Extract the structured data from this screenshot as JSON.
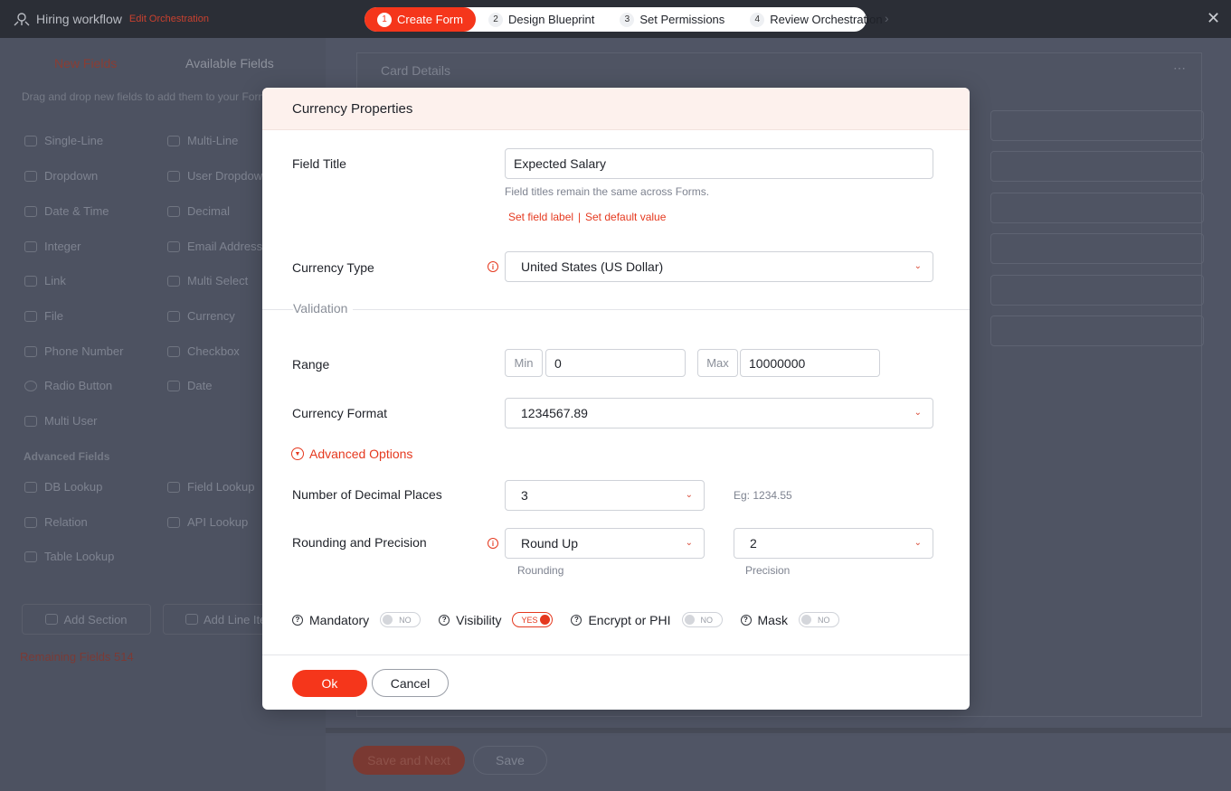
{
  "app": {
    "title": "Hiring workflow",
    "subtitle": "Edit Orchestration"
  },
  "steps": [
    {
      "num": "1",
      "label": "Create Form",
      "active": true
    },
    {
      "num": "2",
      "label": "Design Blueprint"
    },
    {
      "num": "3",
      "label": "Set Permissions"
    },
    {
      "num": "4",
      "label": "Review Orchestration"
    }
  ],
  "left": {
    "tab_new": "New Fields",
    "tab_available": "Available Fields",
    "hint": "Drag and drop new fields to add them to your Form",
    "fields": [
      {
        "label": "Single-Line",
        "icon": "single-line-icon"
      },
      {
        "label": "Multi-Line",
        "icon": "multi-line-icon"
      },
      {
        "label": "Dropdown",
        "icon": "dropdown-icon"
      },
      {
        "label": "User Dropdown",
        "icon": "user-dropdown-icon"
      },
      {
        "label": "Date & Time",
        "icon": "date-time-icon"
      },
      {
        "label": "Decimal",
        "icon": "decimal-icon"
      },
      {
        "label": "Integer",
        "icon": "integer-icon"
      },
      {
        "label": "Email Address",
        "icon": "email-icon"
      },
      {
        "label": "Link",
        "icon": "link-icon"
      },
      {
        "label": "Multi Select",
        "icon": "multi-select-icon"
      },
      {
        "label": "File",
        "icon": "file-icon"
      },
      {
        "label": "Currency",
        "icon": "currency-icon"
      },
      {
        "label": "Phone Number",
        "icon": "phone-icon"
      },
      {
        "label": "Checkbox",
        "icon": "checkbox-icon"
      },
      {
        "label": "Radio Button",
        "icon": "radio-icon"
      },
      {
        "label": "Date",
        "icon": "date-icon"
      },
      {
        "label": "Multi User",
        "icon": "multi-user-icon"
      }
    ],
    "advanced_heading": "Advanced Fields",
    "advanced_fields": [
      {
        "label": "DB Lookup",
        "icon": "db-lookup-icon"
      },
      {
        "label": "Field Lookup",
        "icon": "field-lookup-icon"
      },
      {
        "label": "Relation",
        "icon": "relation-icon"
      },
      {
        "label": "API Lookup",
        "icon": "api-lookup-icon"
      },
      {
        "label": "Table Lookup",
        "icon": "table-lookup-icon"
      }
    ],
    "add_section": "Add Section",
    "add_line_item": "Add Line Item",
    "remaining": "Remaining Fields 514"
  },
  "canvas": {
    "card_title": "Card Details",
    "save_next": "Save and Next",
    "save": "Save"
  },
  "modal": {
    "title": "Currency Properties",
    "field_title_label": "Field Title",
    "field_title_value": "Expected Salary",
    "field_title_hint": "Field titles remain the same across Forms.",
    "set_field_label": "Set field label",
    "link_sep": "|",
    "set_default_value": "Set default value",
    "currency_type_label": "Currency Type",
    "currency_type_value": "United States (US Dollar)",
    "validation_label": "Validation",
    "range_label": "Range",
    "min_label": "Min",
    "min_value": "0",
    "max_label": "Max",
    "max_value": "10000000",
    "currency_format_label": "Currency Format",
    "currency_format_value": "1234567.89",
    "advanced_options": "Advanced Options",
    "decimal_places_label": "Number of Decimal Places",
    "decimal_places_value": "3",
    "decimal_example": "Eg: 1234.55",
    "rounding_label": "Rounding and Precision",
    "rounding_value": "Round Up",
    "rounding_caption": "Rounding",
    "precision_value": "2",
    "precision_caption": "Precision",
    "toggles": [
      {
        "label": "Mandatory",
        "state": "NO",
        "on": false
      },
      {
        "label": "Visibility",
        "state": "YES",
        "on": true
      },
      {
        "label": "Encrypt or PHI",
        "state": "NO",
        "on": false
      },
      {
        "label": "Mask",
        "state": "NO",
        "on": false
      }
    ],
    "ok": "Ok",
    "cancel": "Cancel"
  },
  "colors": {
    "accent": "#f5361b",
    "topbar": "#2b2e36",
    "overlay": "#4d5261",
    "modal_header": "#fdf1ed"
  }
}
